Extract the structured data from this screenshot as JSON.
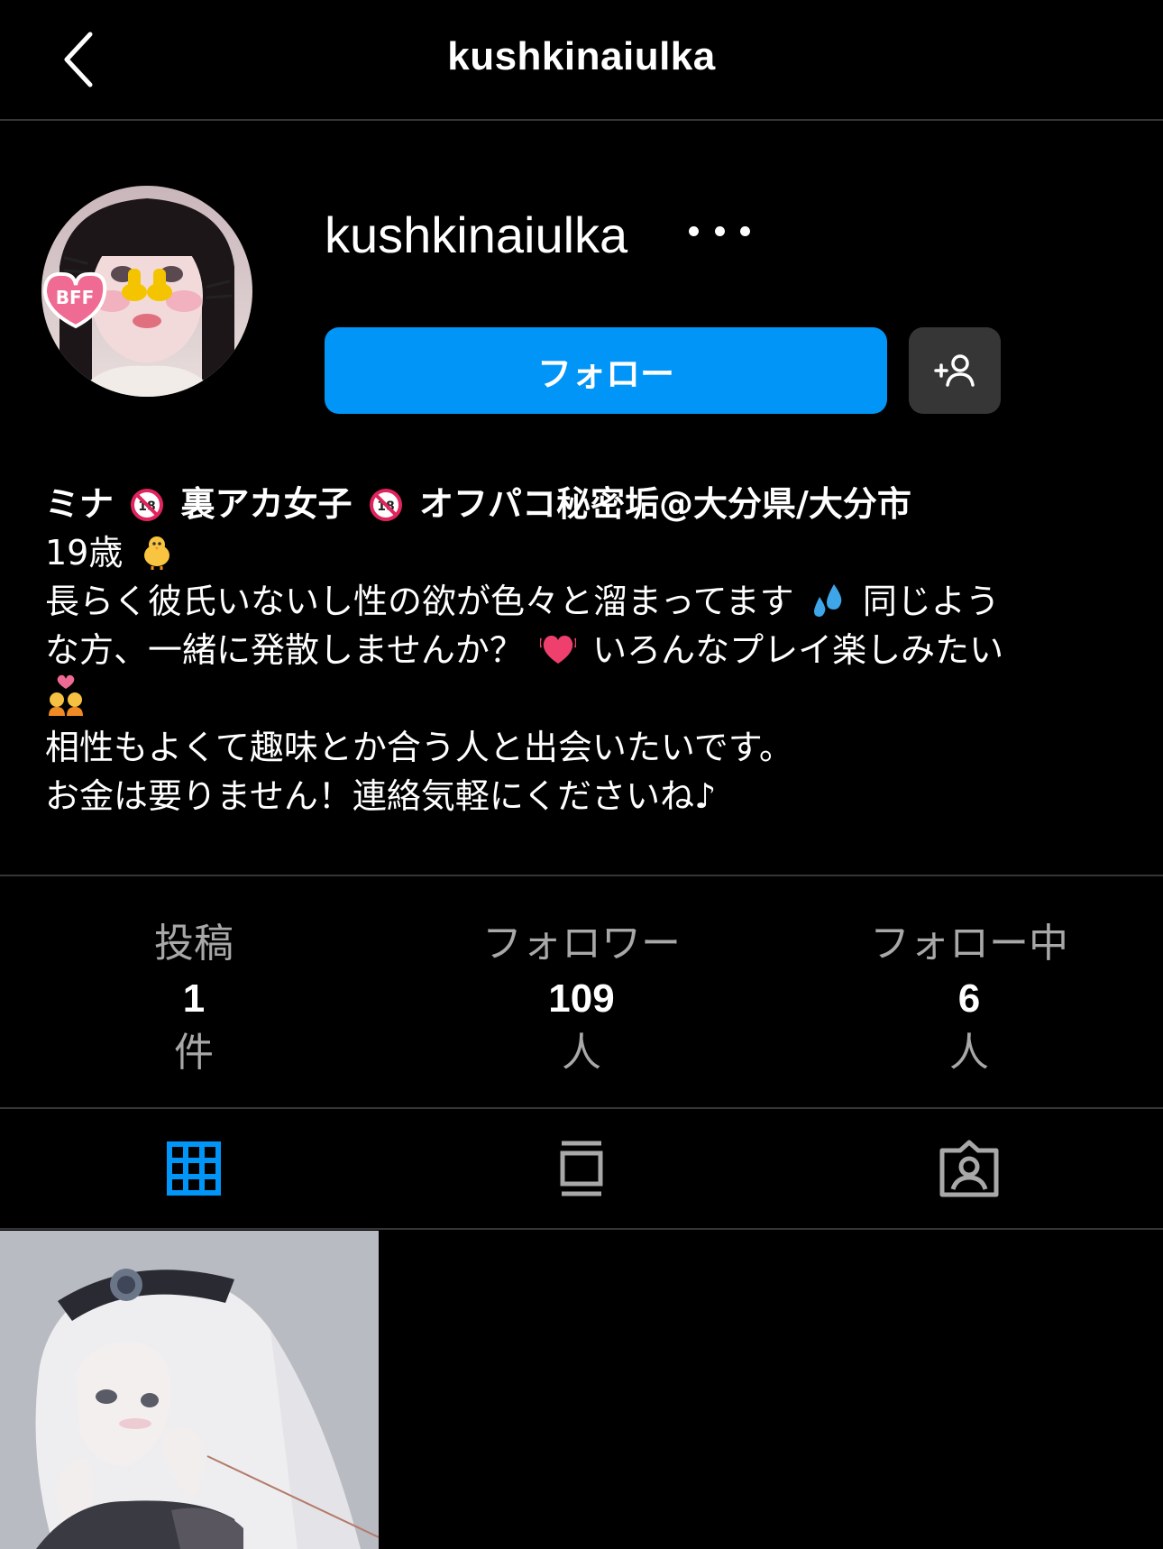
{
  "header": {
    "title": "kushkinaiulka",
    "back_icon": "chevron-left-icon"
  },
  "profile": {
    "username": "kushkinaiulka",
    "follow_label": "フォロー",
    "more_icon": "ellipsis-icon",
    "suggest_icon": "add-person-icon"
  },
  "bio": {
    "name_line": [
      "ミナ",
      "裏アカ女子",
      "オフパコ秘密垢@大分県/大分市"
    ],
    "age": "19歳",
    "line1a": "長らく彼氏いないし性の欲が色々と溜まってます",
    "line1b": "同じよう",
    "line2a": "な方、一緒に発散しませんか？",
    "line2b": "いろんなプレイ楽しみたい",
    "line3": "相性もよくて趣味とか合う人と出会いたいです。",
    "line4": "お金は要りません！連絡気軽にくださいね♪"
  },
  "stats": [
    {
      "label": "投稿",
      "value": "1",
      "unit": "件"
    },
    {
      "label": "フォロワー",
      "value": "109",
      "unit": "人"
    },
    {
      "label": "フォロー中",
      "value": "6",
      "unit": "人"
    }
  ],
  "tabs": [
    {
      "icon": "grid-icon",
      "active": true
    },
    {
      "icon": "feed-icon",
      "active": false
    },
    {
      "icon": "tagged-icon",
      "active": false
    }
  ],
  "colors": {
    "accent": "#0095f6",
    "background": "#000000",
    "divider": "#363636",
    "muted_text": "#a8a8a8"
  }
}
